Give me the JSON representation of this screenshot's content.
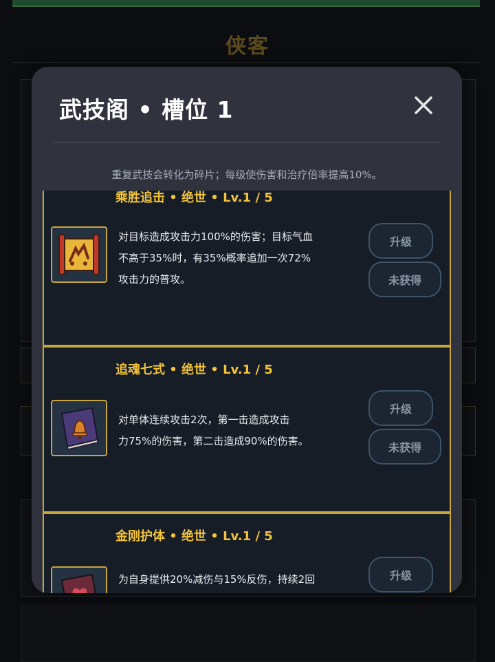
{
  "background": {
    "title": "侠客"
  },
  "modal": {
    "title": "武技阁 • 槽位 1",
    "notice": "重复武技会转化为碎片；每级使伤害和治疗倍率提高10%。"
  },
  "skills": [
    {
      "title": "乘胜追击 • 绝世 • Lv.1 / 5",
      "icon": "scroll-icon",
      "desc": [
        "对目标造成攻击力100%的伤害；目标气血",
        "不高于35%时，有35%概率追加一次72%",
        "攻击力的普攻。"
      ],
      "upgrade_label": "升级",
      "status_label": "未获得"
    },
    {
      "title": "追魂七式 • 绝世 • Lv.1 / 5",
      "icon": "book-bell-icon",
      "desc": [
        "对单体连续攻击2次，第一击造成攻击",
        "力75%的伤害，第二击造成90%的伤害。"
      ],
      "upgrade_label": "升级",
      "status_label": "未获得"
    },
    {
      "title": "金刚护体 • 绝世 • Lv.1 / 5",
      "icon": "book-heart-icon",
      "desc": [
        "为自身提供20%减伤与15%反伤，持续2回"
      ],
      "upgrade_label": "升级"
    }
  ],
  "colors": {
    "accent_gold": "#f2c33b",
    "card_border": "#c9a640",
    "modal_bg": "#30333e"
  }
}
